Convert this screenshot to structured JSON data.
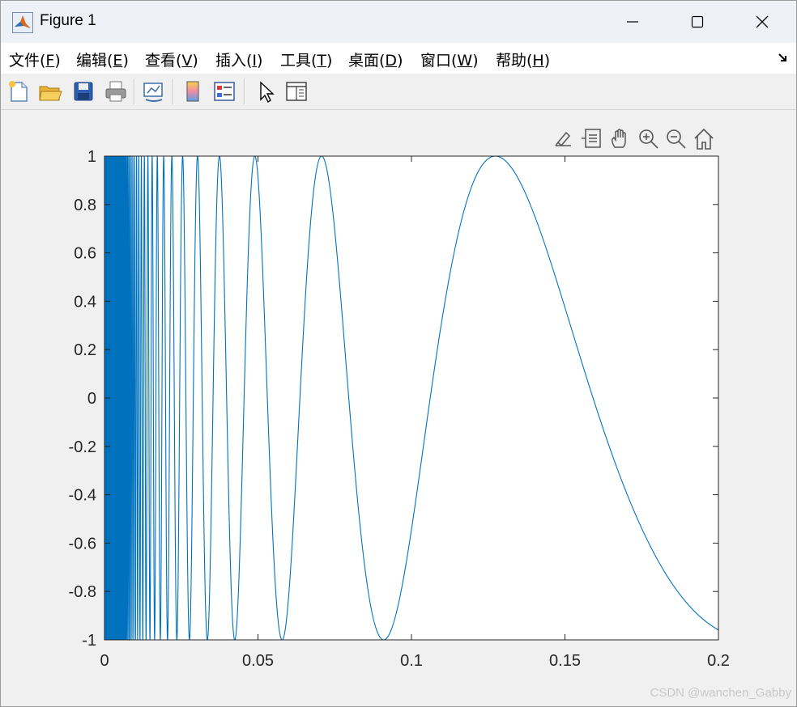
{
  "window": {
    "title": "Figure 1",
    "minimize_label": "—",
    "maximize_label": "☐",
    "close_label": "✕"
  },
  "menu": {
    "items": [
      {
        "text": "文件(",
        "key": "F",
        "tail": ")"
      },
      {
        "text": "编辑(",
        "key": "E",
        "tail": ")"
      },
      {
        "text": "查看(",
        "key": "V",
        "tail": ")"
      },
      {
        "text": "插入(",
        "key": "I",
        "tail": ")"
      },
      {
        "text": "工具(",
        "key": "T",
        "tail": ")"
      },
      {
        "text": "桌面(",
        "key": "D",
        "tail": ")"
      },
      {
        "text": "窗口(",
        "key": "W",
        "tail": ")"
      },
      {
        "text": "帮助(",
        "key": "H",
        "tail": ")"
      }
    ]
  },
  "toolbar": {
    "icons": [
      "new-figure-icon",
      "open-file-icon",
      "save-icon",
      "print-icon",
      "link-plot-icon",
      "colorbar-icon",
      "legend-icon",
      "edit-plot-arrow-icon",
      "property-inspector-icon"
    ]
  },
  "axes_toolbar": {
    "icons": [
      "brush-icon",
      "data-tips-icon",
      "pan-hand-icon",
      "zoom-in-icon",
      "zoom-out-icon",
      "home-icon"
    ]
  },
  "chart_data": {
    "type": "line",
    "function": "sin(1/x)",
    "x_range": [
      0,
      0.2
    ],
    "xlim": [
      0,
      0.2
    ],
    "ylim": [
      -1,
      1
    ],
    "xticks": [
      "0",
      "0.05",
      "0.1",
      "0.15",
      "0.2"
    ],
    "xtick_values": [
      0,
      0.05,
      0.1,
      0.15,
      0.2
    ],
    "yticks": [
      "1",
      "0.8",
      "0.6",
      "0.4",
      "0.2",
      "0",
      "-0.2",
      "-0.4",
      "-0.6",
      "-0.8",
      "-1"
    ],
    "ytick_values": [
      1,
      0.8,
      0.6,
      0.4,
      0.2,
      0,
      -0.2,
      -0.4,
      -0.6,
      -0.8,
      -1
    ],
    "line_color": "#0072BD",
    "grid": false,
    "title": "",
    "xlabel": "",
    "ylabel": ""
  },
  "watermark": "CSDN @wanchen_Gabby"
}
